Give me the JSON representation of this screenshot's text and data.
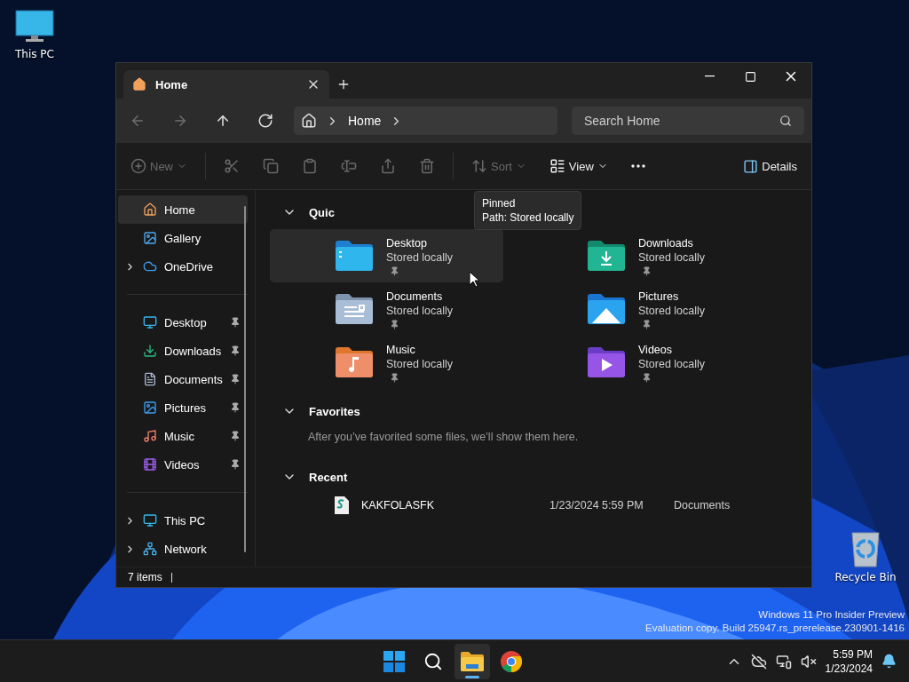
{
  "desktop": {
    "icons": [
      {
        "label": "This PC",
        "kind": "pc"
      },
      {
        "label": "Recycle Bin",
        "kind": "bin"
      }
    ],
    "watermark": [
      "Windows 11 Pro Insider Preview",
      "Evaluation copy. Build 25947.rs_prerelease.230901-1416"
    ]
  },
  "window": {
    "tabs": [
      {
        "label": "Home",
        "selected": true
      }
    ],
    "nav": [
      {
        "kind": "back",
        "disabled": true
      },
      {
        "kind": "forward",
        "disabled": true
      },
      {
        "kind": "up",
        "disabled": false
      },
      {
        "kind": "refresh",
        "disabled": false
      }
    ],
    "breadcrumbs": [
      "Home"
    ],
    "search": {
      "placeholder": "Search Home"
    },
    "toolbar": [
      {
        "kind": "new",
        "label": "New",
        "disabled": true
      },
      {
        "kind": "cut",
        "disabled": true
      },
      {
        "kind": "copy",
        "disabled": true
      },
      {
        "kind": "paste",
        "disabled": true
      },
      {
        "kind": "rename",
        "disabled": true
      },
      {
        "kind": "share",
        "disabled": true
      },
      {
        "kind": "delete",
        "disabled": true
      },
      {
        "kind": "sort",
        "label": "Sort",
        "disabled": true
      },
      {
        "kind": "view",
        "label": "View",
        "disabled": false
      },
      {
        "kind": "more",
        "disabled": false
      }
    ],
    "details": "Details",
    "sidebar": [
      [
        {
          "label": "Home",
          "kind": "home",
          "selected": true,
          "expandable": false,
          "pinned": false
        },
        {
          "label": "Gallery",
          "kind": "gallery",
          "selected": false,
          "expandable": false,
          "pinned": false
        },
        {
          "label": "OneDrive",
          "kind": "cloud",
          "selected": false,
          "expandable": true,
          "pinned": false
        }
      ],
      [
        {
          "label": "Desktop",
          "kind": "desktop",
          "selected": false,
          "expandable": false,
          "pinned": true
        },
        {
          "label": "Downloads",
          "kind": "downloads",
          "selected": false,
          "expandable": false,
          "pinned": true
        },
        {
          "label": "Documents",
          "kind": "documents",
          "selected": false,
          "expandable": false,
          "pinned": true
        },
        {
          "label": "Pictures",
          "kind": "pictures",
          "selected": false,
          "expandable": false,
          "pinned": true
        },
        {
          "label": "Music",
          "kind": "music",
          "selected": false,
          "expandable": false,
          "pinned": true
        },
        {
          "label": "Videos",
          "kind": "videos",
          "selected": false,
          "expandable": false,
          "pinned": true
        }
      ],
      [
        {
          "label": "This PC",
          "kind": "pc",
          "selected": false,
          "expandable": true,
          "pinned": false
        },
        {
          "label": "Network",
          "kind": "network",
          "selected": false,
          "expandable": true,
          "pinned": false
        }
      ]
    ],
    "quick_access": {
      "title": "Quic",
      "expanded": true,
      "items": [
        {
          "name": "Desktop",
          "status": "Stored locally",
          "kind": "desktop",
          "hovered": true,
          "pinned": true
        },
        {
          "name": "Downloads",
          "status": "Stored locally",
          "kind": "downloads",
          "hovered": false,
          "pinned": true
        },
        {
          "name": "Documents",
          "status": "Stored locally",
          "kind": "documents",
          "hovered": false,
          "pinned": true
        },
        {
          "name": "Pictures",
          "status": "Stored locally",
          "kind": "pictures",
          "hovered": false,
          "pinned": true
        },
        {
          "name": "Music",
          "status": "Stored locally",
          "kind": "music",
          "hovered": false,
          "pinned": true
        },
        {
          "name": "Videos",
          "status": "Stored locally",
          "kind": "videos",
          "hovered": false,
          "pinned": true
        }
      ]
    },
    "tooltip": [
      "Pinned",
      "Path: Stored locally"
    ],
    "favorites": {
      "title": "Favorites",
      "expanded": true,
      "empty_text": "After you’ve favorited some files, we’ll show them here."
    },
    "recent": {
      "title": "Recent",
      "expanded": true,
      "files": [
        {
          "name": "KAKFOLASFK",
          "modified": "1/23/2024 5:59 PM",
          "location": "Documents"
        }
      ]
    },
    "status_bar": "7 items"
  },
  "taskbar": {
    "apps": [
      {
        "kind": "start",
        "active": false
      },
      {
        "kind": "search",
        "active": false
      },
      {
        "kind": "explorer",
        "active": true
      },
      {
        "kind": "chrome",
        "active": false
      }
    ],
    "time": "5:59 PM",
    "date": "1/23/2024"
  }
}
